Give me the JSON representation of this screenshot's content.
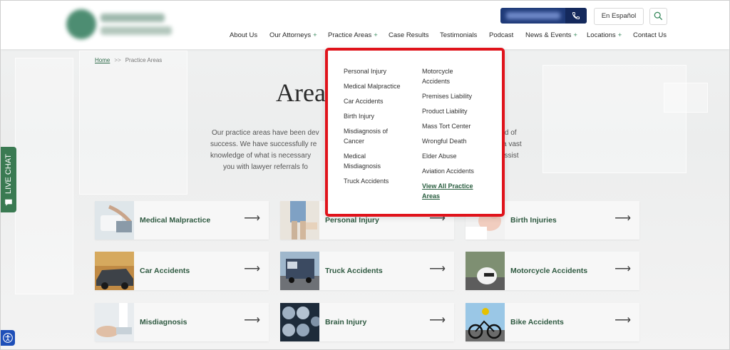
{
  "header": {
    "espanol_label": "En Español",
    "nav": [
      {
        "label": "About Us",
        "plus": false
      },
      {
        "label": "Our Attorneys",
        "plus": true
      },
      {
        "label": "Practice Areas",
        "plus": true
      },
      {
        "label": "Case Results",
        "plus": false
      },
      {
        "label": "Testimonials",
        "plus": false
      },
      {
        "label": "Podcast",
        "plus": false
      },
      {
        "label": "News & Events",
        "plus": true
      },
      {
        "label": "Locations",
        "plus": true
      },
      {
        "label": "Contact Us",
        "plus": false
      }
    ],
    "plus_symbol": "+"
  },
  "breadcrumb": {
    "home": "Home",
    "sep": ">>",
    "current": "Practice Areas"
  },
  "page_title": "Area",
  "intro_lines": [
    "Our practice areas have been dev",
    "success. We have successfully re",
    "knowledge of what is necessary",
    "you with lawyer referrals fo",
    "ord of",
    "a vast",
    "assist"
  ],
  "dropdown": {
    "col1": [
      "Personal Injury",
      "Medical Malpractice",
      "Car Accidents",
      "Birth Injury",
      "Misdiagnosis of Cancer",
      "Medical Misdiagnosis",
      "Truck Accidents"
    ],
    "col2": [
      "Motorcycle Accidents",
      "Premises Liability",
      "Product Liability",
      "Mass Tort Center",
      "Wrongful Death",
      "Elder Abuse",
      "Aviation Accidents"
    ],
    "view_all": "View All Practice Areas"
  },
  "cards": [
    {
      "label": "Medical Malpractice"
    },
    {
      "label": "Personal Injury"
    },
    {
      "label": "Birth Injuries"
    },
    {
      "label": "Car Accidents"
    },
    {
      "label": "Truck Accidents"
    },
    {
      "label": "Motorcycle Accidents"
    },
    {
      "label": "Misdiagnosis"
    },
    {
      "label": "Brain Injury"
    },
    {
      "label": "Bike Accidents"
    }
  ],
  "arrow_symbol": "⟶",
  "live_chat_label": "LIVE CHAT",
  "colors": {
    "accent_green": "#2f5a41",
    "highlight_red": "#e0131b",
    "phone_navy": "#1f3a78"
  }
}
